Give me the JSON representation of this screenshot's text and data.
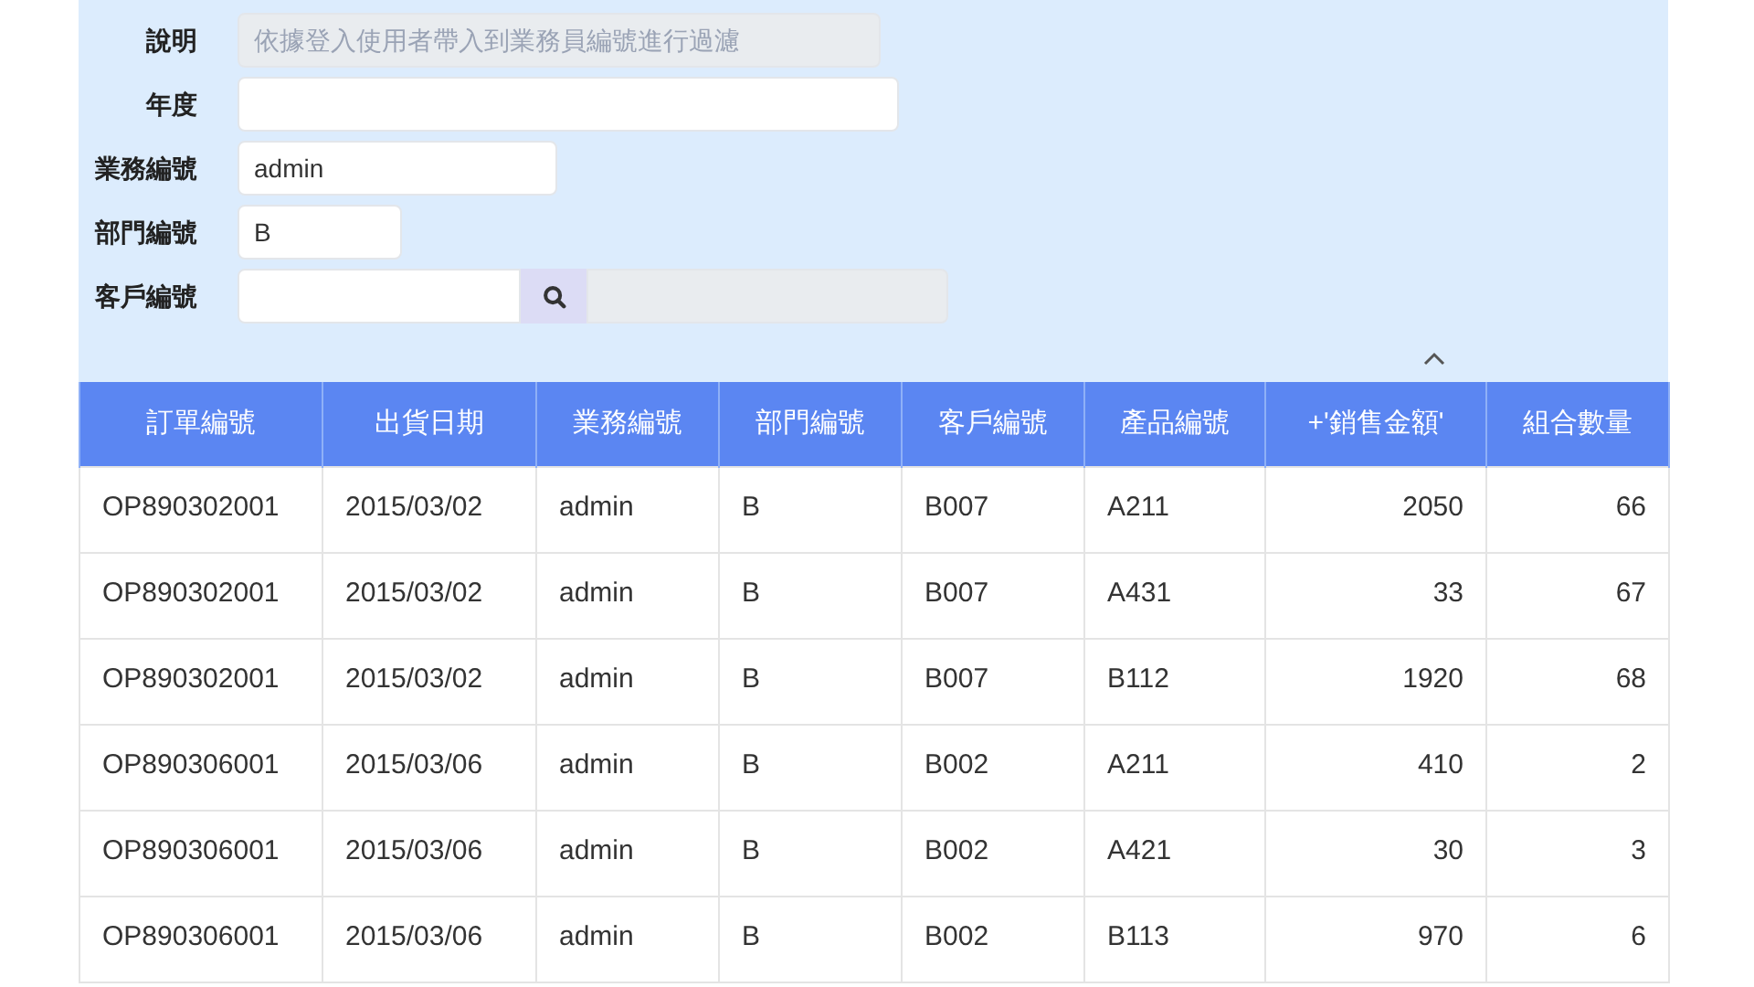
{
  "filter_form": {
    "fields": [
      {
        "kind": "text",
        "label": "說明",
        "placeholder": "依據登入使用者帶入到業務員編號進行過濾",
        "disabled": true
      },
      {
        "kind": "text",
        "label": "年度",
        "disabled": false
      },
      {
        "kind": "text",
        "label": "業務編號",
        "value": "admin",
        "disabled": false
      },
      {
        "kind": "text",
        "label": "部門編號",
        "value": "B",
        "disabled": false
      },
      {
        "kind": "lookup",
        "label": "客戶編號",
        "disabled": false
      }
    ],
    "expanded": true
  },
  "table": {
    "columns": [
      "訂單編號",
      "出貨日期",
      "業務編號",
      "部門編號",
      "客戶編號",
      "產品編號",
      "+'銷售金額'",
      "組合數量"
    ],
    "rows": [
      [
        "OP890302001",
        "2015/03/02",
        "admin",
        "B",
        "B007",
        "A211",
        "2050",
        "66"
      ],
      [
        "OP890302001",
        "2015/03/02",
        "admin",
        "B",
        "B007",
        "A431",
        "33",
        "67"
      ],
      [
        "OP890302001",
        "2015/03/02",
        "admin",
        "B",
        "B007",
        "B112",
        "1920",
        "68"
      ],
      [
        "OP890306001",
        "2015/03/06",
        "admin",
        "B",
        "B002",
        "A211",
        "410",
        "2"
      ],
      [
        "OP890306001",
        "2015/03/06",
        "admin",
        "B",
        "B002",
        "A421",
        "30",
        "3"
      ],
      [
        "OP890306001",
        "2015/03/06",
        "admin",
        "B",
        "B002",
        "B113",
        "970",
        "6"
      ]
    ]
  }
}
